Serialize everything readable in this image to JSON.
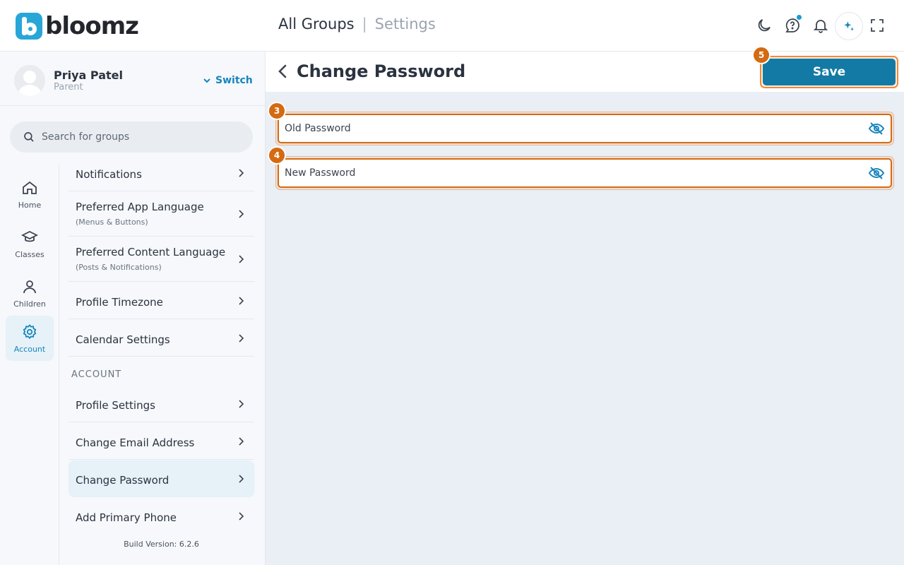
{
  "header": {
    "logo_text": "bloomz",
    "crumb_main": "All Groups",
    "crumb_sep": "|",
    "crumb_sub": "Settings",
    "icons": [
      "moon-icon",
      "help-chat-icon",
      "bell-icon",
      "sparkle-icon",
      "fullscreen-icon"
    ]
  },
  "profile": {
    "name": "Priya Patel",
    "role": "Parent",
    "switch_label": "Switch"
  },
  "search": {
    "placeholder": "Search for groups"
  },
  "rail": {
    "items": [
      {
        "label": "Home"
      },
      {
        "label": "Classes"
      },
      {
        "label": "Children"
      },
      {
        "label": "Account"
      }
    ]
  },
  "menu": {
    "items": [
      {
        "label": "Notifications"
      },
      {
        "label": "Preferred App Language",
        "sub": "(Menus & Buttons)"
      },
      {
        "label": "Preferred Content Language",
        "sub": "(Posts & Notifications)"
      },
      {
        "label": "Profile Timezone"
      },
      {
        "label": "Calendar Settings"
      }
    ],
    "section_label": "ACCOUNT",
    "account_items": [
      {
        "label": "Profile Settings"
      },
      {
        "label": "Change Email Address"
      },
      {
        "label": "Change Password"
      },
      {
        "label": "Add Primary Phone"
      }
    ],
    "build": "Build Version: 6.2.6"
  },
  "main": {
    "title": "Change Password",
    "save_label": "Save",
    "old_password_placeholder": "Old Password",
    "new_password_placeholder": "New Password",
    "badges": {
      "save": "5",
      "old": "3",
      "new": "4"
    }
  },
  "colors": {
    "accent": "#137aa5",
    "highlight": "#d46a12"
  }
}
